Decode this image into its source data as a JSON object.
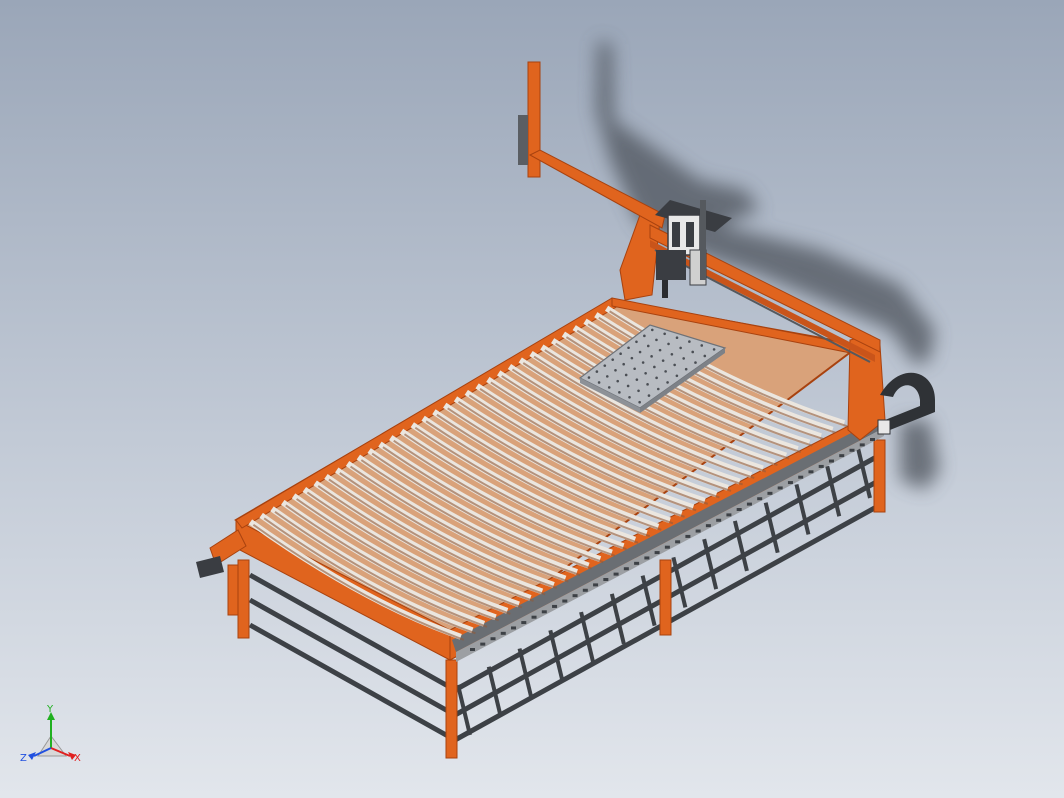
{
  "viewport": {
    "colors": {
      "background_top": "#9aa6b8",
      "background_bottom": "#e2e6ec",
      "frame_orange": "#e0641e",
      "frame_orange_dark": "#a8420f",
      "slat_light": "#ebe6df",
      "slat_shade": "#b9b0a4",
      "rail_dark": "#55595e",
      "plate_grey": "#b8bcc2",
      "torch_dark": "#3a3d42",
      "shadow": "#4d535b"
    }
  },
  "model": {
    "name": "cnc-plasma-cutting-table",
    "description_icons": [
      "gantry",
      "cable-chain",
      "slat-bed",
      "torch-head",
      "work-plate"
    ]
  },
  "triad": {
    "x_label": "X",
    "y_label": "Y",
    "z_label": "Z",
    "x_color": "#e02020",
    "y_color": "#20b020",
    "z_color": "#2050e0"
  }
}
